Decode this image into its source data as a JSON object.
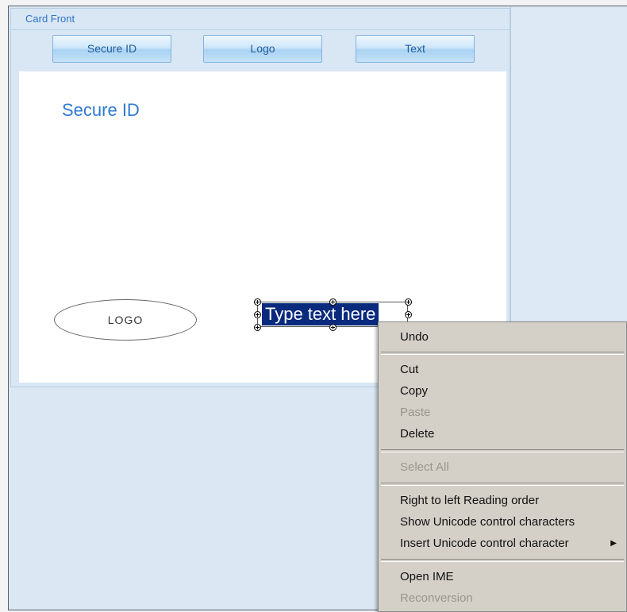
{
  "panel": {
    "title": "Card Front"
  },
  "toolbar": {
    "secure_id_label": "Secure ID",
    "logo_label": "Logo",
    "text_label": "Text"
  },
  "canvas": {
    "heading": "Secure ID",
    "logo_text": "LOGO",
    "textbox_value": "Type text here"
  },
  "context_menu": {
    "undo": "Undo",
    "cut": "Cut",
    "copy": "Copy",
    "paste": "Paste",
    "delete": "Delete",
    "select_all": "Select All",
    "rtl": "Right to left Reading order",
    "show_unicode": "Show Unicode control characters",
    "insert_unicode": "Insert Unicode control character",
    "open_ime": "Open IME",
    "reconversion": "Reconversion",
    "submenu_arrow": "▶"
  }
}
